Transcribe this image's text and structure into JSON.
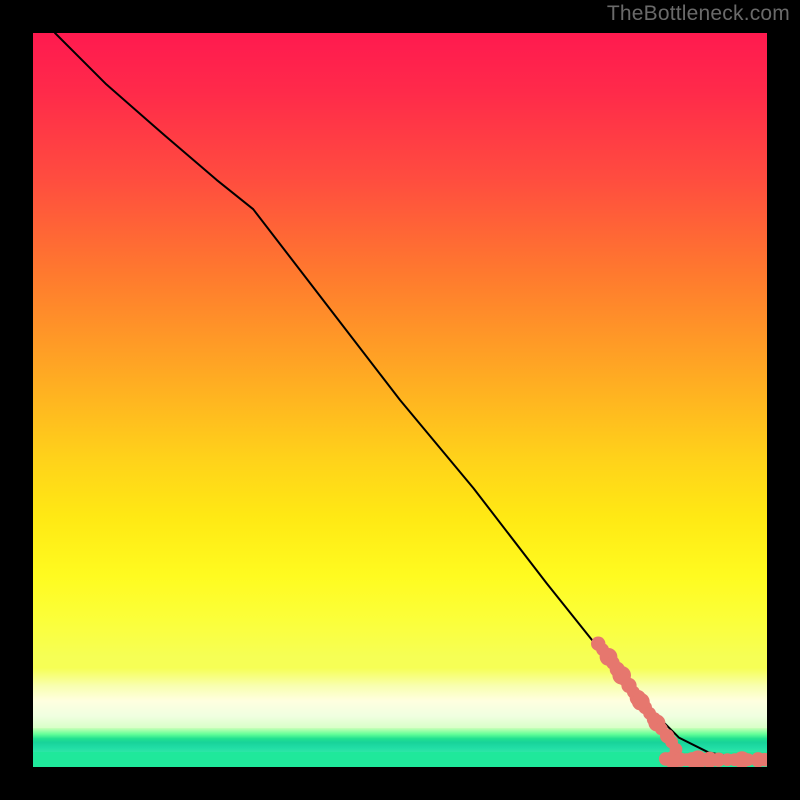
{
  "watermark": "TheBottleneck.com",
  "chart_data": {
    "type": "line",
    "title": "",
    "xlabel": "",
    "ylabel": "",
    "xlim": [
      0,
      100
    ],
    "ylim": [
      0,
      100
    ],
    "grid": false,
    "legend": false,
    "note": "Axes are unlabeled; values are normalized 0–100 where y=100 is the top edge and x=100 is the right edge.",
    "background_gradient": {
      "orientation": "vertical",
      "stops": [
        {
          "pos": 0,
          "color": "#ff1a4f"
        },
        {
          "pos": 20,
          "color": "#ff4d3f"
        },
        {
          "pos": 45,
          "color": "#ffa424"
        },
        {
          "pos": 70,
          "color": "#fffb20"
        },
        {
          "pos": 88,
          "color": "#ffffe0"
        },
        {
          "pos": 96,
          "color": "#20e090"
        },
        {
          "pos": 100,
          "color": "#1fe89b"
        }
      ]
    },
    "series": [
      {
        "name": "curve",
        "kind": "line",
        "color": "#000000",
        "x": [
          3,
          10,
          18,
          25,
          30,
          40,
          50,
          60,
          70,
          78,
          82,
          85,
          88,
          92,
          96,
          100
        ],
        "y": [
          100,
          93,
          86,
          80,
          76,
          63,
          50,
          38,
          25,
          15,
          10,
          7,
          4,
          2,
          1.2,
          1
        ]
      },
      {
        "name": "markers",
        "kind": "scatter",
        "color": "#e6776e",
        "points": [
          {
            "x": 77.0,
            "y": 16.8,
            "r": 1.2
          },
          {
            "x": 77.6,
            "y": 16.0,
            "r": 1.0
          },
          {
            "x": 78.4,
            "y": 15.0,
            "r": 1.6
          },
          {
            "x": 79.0,
            "y": 14.2,
            "r": 1.1
          },
          {
            "x": 79.6,
            "y": 13.3,
            "r": 1.3
          },
          {
            "x": 80.2,
            "y": 12.5,
            "r": 1.7
          },
          {
            "x": 80.6,
            "y": 11.9,
            "r": 1.0
          },
          {
            "x": 81.2,
            "y": 11.1,
            "r": 1.3
          },
          {
            "x": 81.8,
            "y": 10.2,
            "r": 1.0
          },
          {
            "x": 82.4,
            "y": 9.4,
            "r": 1.4
          },
          {
            "x": 82.8,
            "y": 8.9,
            "r": 1.6
          },
          {
            "x": 83.4,
            "y": 8.1,
            "r": 1.1
          },
          {
            "x": 84.0,
            "y": 7.3,
            "r": 1.0
          },
          {
            "x": 84.6,
            "y": 6.5,
            "r": 1.2
          },
          {
            "x": 85.0,
            "y": 6.0,
            "r": 1.5
          },
          {
            "x": 85.6,
            "y": 5.2,
            "r": 1.0
          },
          {
            "x": 86.4,
            "y": 4.2,
            "r": 1.2
          },
          {
            "x": 87.0,
            "y": 3.4,
            "r": 1.0
          },
          {
            "x": 87.6,
            "y": 2.4,
            "r": 1.0
          },
          {
            "x": 86.2,
            "y": 1.1,
            "r": 1.1
          },
          {
            "x": 87.2,
            "y": 1.0,
            "r": 1.6
          },
          {
            "x": 88.2,
            "y": 1.0,
            "r": 1.2
          },
          {
            "x": 89.0,
            "y": 1.0,
            "r": 1.0
          },
          {
            "x": 89.8,
            "y": 1.0,
            "r": 1.3
          },
          {
            "x": 90.6,
            "y": 1.0,
            "r": 1.7
          },
          {
            "x": 91.4,
            "y": 1.0,
            "r": 1.1
          },
          {
            "x": 92.2,
            "y": 1.0,
            "r": 1.4
          },
          {
            "x": 93.4,
            "y": 1.0,
            "r": 1.2
          },
          {
            "x": 94.6,
            "y": 1.0,
            "r": 1.0
          },
          {
            "x": 95.6,
            "y": 1.0,
            "r": 1.0
          },
          {
            "x": 96.6,
            "y": 1.0,
            "r": 1.5
          },
          {
            "x": 97.4,
            "y": 1.0,
            "r": 1.0
          },
          {
            "x": 98.8,
            "y": 1.0,
            "r": 1.3
          },
          {
            "x": 99.7,
            "y": 1.0,
            "r": 1.1
          }
        ]
      }
    ]
  }
}
